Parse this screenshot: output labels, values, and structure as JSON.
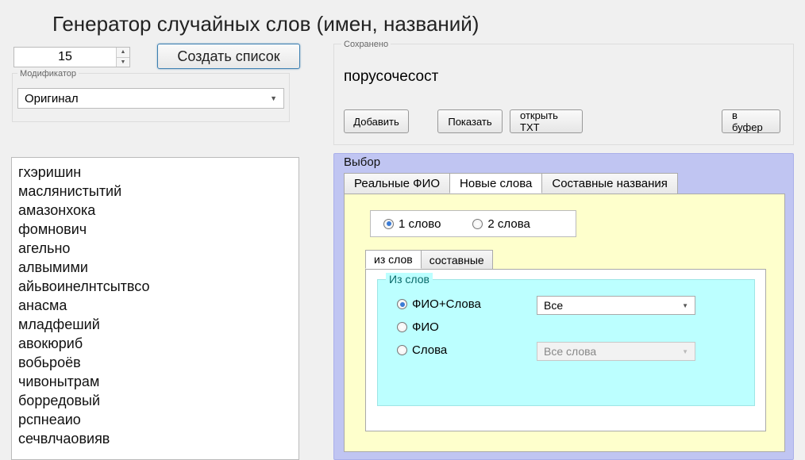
{
  "title": "Генератор случайных слов (имен, названий)",
  "count_value": "15",
  "create_button": "Создать список",
  "modifier_legend": "Модификатор",
  "modifier_value": "Оригинал",
  "word_list": [
    "гхэришин",
    "маслянистытий",
    "амазонхока",
    "фомнович",
    "агельно",
    "алвымими",
    "айьвоинелнтсытвсо",
    "анасма",
    "младфеший",
    "авокюриб",
    "вобьроёв",
    "чивонытрам",
    "борредовый",
    "рспнеаио",
    "сечвлчаовияв"
  ],
  "saved": {
    "legend": "Сохранено",
    "word": "порусочесост",
    "add": "Добавить",
    "show": "Показать",
    "open_txt": "открыть TXT",
    "to_buffer": "в буфер"
  },
  "selection": {
    "legend": "Выбор",
    "tabs": [
      "Реальные ФИО",
      "Новые слова",
      "Составные названия"
    ],
    "active_tab": 1,
    "wordcount": {
      "one": "1 слово",
      "two": "2 слова",
      "selected": "one"
    },
    "inner_tabs": [
      "из слов",
      "составные"
    ],
    "inner_active": 0,
    "fromwords": {
      "legend": "Из слов",
      "options": [
        "ФИО+Слова",
        "ФИО",
        "Слова"
      ],
      "selected": 0,
      "dropdown1": "Все",
      "dropdown2": "Все слова"
    }
  }
}
